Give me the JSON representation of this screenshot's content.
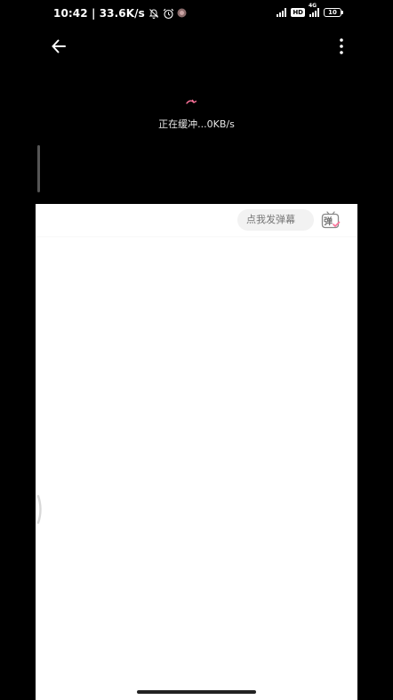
{
  "status_bar": {
    "time_speed": "10:42 | 33.6K/s",
    "hd_badge": "HD",
    "network_type": "4G",
    "battery_level": "10"
  },
  "player": {
    "buffering_text": "正在缓冲...0KB/s"
  },
  "danmaku": {
    "placeholder": "点我发弹幕",
    "toggle_char": "弹"
  },
  "colors": {
    "spinner": "#fb7299",
    "danmaku_toggle_check": "#fb7299",
    "panel_background": "#ffffff"
  },
  "icons": {
    "back": "arrow-left-icon",
    "more": "more-vertical-icon",
    "mute": "bell-off-icon",
    "alarm": "alarm-clock-icon",
    "app_notify": "app-notification-icon"
  }
}
